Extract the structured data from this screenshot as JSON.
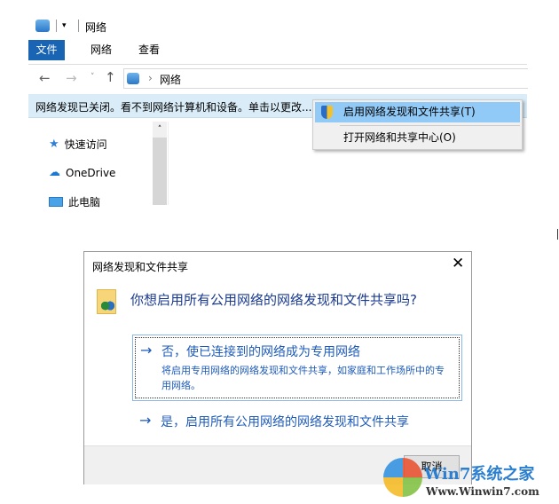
{
  "window": {
    "title": "网络"
  },
  "ribbon": {
    "tabs": [
      "文件",
      "网络",
      "查看"
    ]
  },
  "address": {
    "path": "网络"
  },
  "infobar": {
    "text": "网络发现已关闭。看不到网络计算机和设备。单击以更改..."
  },
  "context_menu": {
    "items": [
      "启用网络发现和文件共享(T)",
      "打开网络和共享中心(O)"
    ]
  },
  "sidebar": {
    "items": [
      "快速访问",
      "OneDrive",
      "此电脑"
    ]
  },
  "dialog": {
    "title": "网络发现和文件共享",
    "question": "你想启用所有公用网络的网络发现和文件共享吗?",
    "option_no": {
      "title": "否，使已连接到的网络成为专用网络",
      "desc": "将启用专用网络的网络发现和文件共享，如家庭和工作场所中的专用网络。"
    },
    "option_yes": {
      "title": "是，启用所有公用网络的网络发现和文件共享"
    },
    "cancel": "取消"
  },
  "watermark": {
    "brand": "Win7系统之家",
    "url": "Www.Winwin7.com"
  }
}
